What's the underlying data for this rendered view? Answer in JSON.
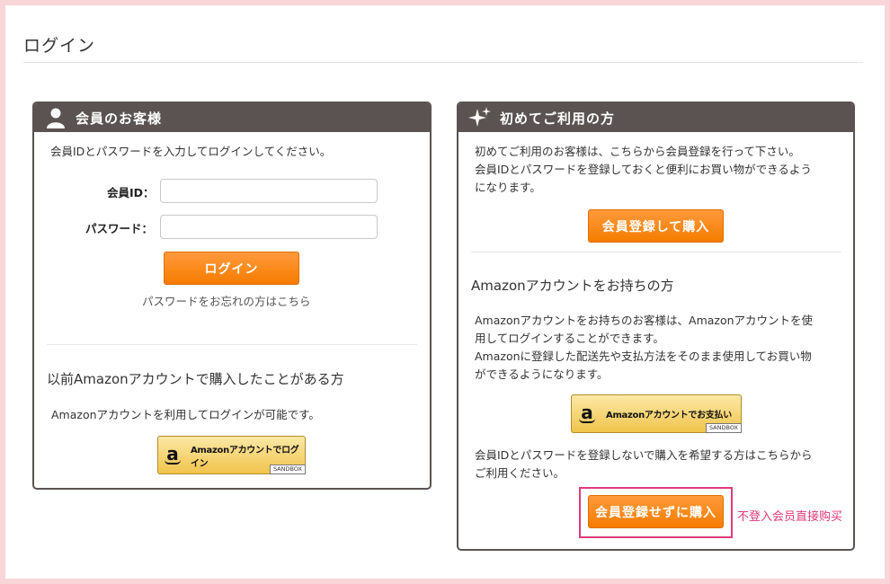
{
  "page": {
    "title": "ログイン"
  },
  "member": {
    "heading": "会員のお客様",
    "intro": "会員IDとパスワードを入力してログインしてください。",
    "id_label": "会員ID：",
    "id_value": "",
    "password_label": "パスワード：",
    "password_value": "",
    "login_button": "ログイン",
    "forgot_link": "パスワードをお忘れの方はこちら",
    "amazon_section_title": "以前Amazonアカウントで購入したことがある方",
    "amazon_section_text": "Amazonアカウントを利用してログインが可能です。",
    "amazon_button": {
      "logo": "a",
      "label": "Amazonアカウントでログイン",
      "badge": "SANDBOX"
    }
  },
  "newuser": {
    "heading": "初めてご利用の方",
    "intro_line1": "初めてご利用のお客様は、こちらから会員登録を行って下さい。",
    "intro_line2": "会員IDとパスワードを登録しておくと便利にお買い物ができるよう",
    "intro_line3": "になります。",
    "register_button": "会員登録して購入",
    "amazon_section_title": "Amazonアカウントをお持ちの方",
    "amazon_line1": "Amazonアカウントをお持ちのお客様は、Amazonアカウントを使",
    "amazon_line2": "用してログインすることができます。",
    "amazon_line3": "Amazonに登録した配送先や支払方法をそのまま使用してお買い物",
    "amazon_line4": "ができるようになります。",
    "amazon_button": {
      "logo": "a",
      "label": "Amazonアカウントでお支払い",
      "badge": "SANDBOX"
    },
    "guest_line1": "会員IDとパスワードを登録しないで購入を希望する方はこちらから",
    "guest_line2": "ご利用ください。",
    "guest_button": "会員登録せずに購入"
  },
  "annotation": {
    "text": "不登入会员直接购买"
  },
  "colors": {
    "outer_background": "#f8d5d9",
    "panel_header": "#5a5351",
    "orange_button": "#f57c00",
    "amazon_button": "#f1c44c",
    "annotation": "#e0397a"
  },
  "icons": {
    "member_heading": "user-icon",
    "newuser_heading": "sparkle-icon"
  }
}
